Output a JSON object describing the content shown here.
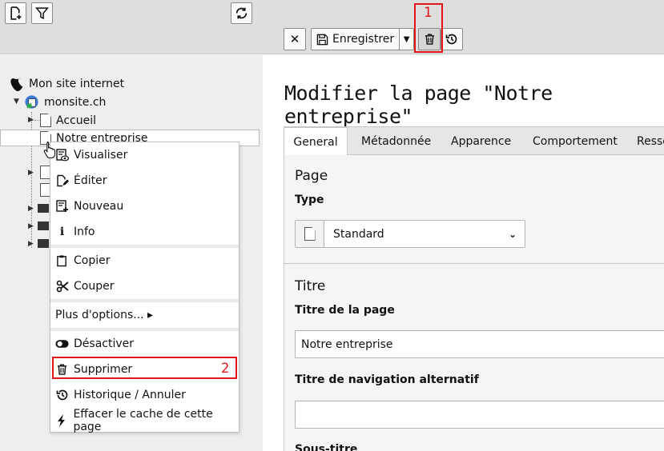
{
  "toolbar": {
    "new_page_icon": "new-page-icon",
    "filter_icon": "filter-icon",
    "refresh_icon": "refresh-icon"
  },
  "doc_toolbar": {
    "close_symbol": "✕",
    "save_label": "Enregistrer",
    "delete_icon": "trash-icon",
    "history_icon": "history-icon"
  },
  "annotations": {
    "one": "1",
    "two": "2",
    "color": "#e3131a"
  },
  "tree": {
    "root": "Mon site internet",
    "site": "monsite.ch",
    "home": "Accueil",
    "selected": "Notre entreprise"
  },
  "context_menu": {
    "items": [
      {
        "label": "Visualiser",
        "icon": "view-icon"
      },
      {
        "label": "Éditer",
        "icon": "edit-icon"
      },
      {
        "label": "Nouveau",
        "icon": "new-icon"
      },
      {
        "label": "Info",
        "icon": "info-icon"
      },
      {
        "label": "Copier",
        "icon": "copy-icon"
      },
      {
        "label": "Couper",
        "icon": "cut-icon"
      },
      {
        "label": "Plus d'options... ▸",
        "icon": ""
      },
      {
        "label": "Désactiver",
        "icon": "toggle-icon"
      },
      {
        "label": "Supprimer",
        "icon": "trash-icon"
      },
      {
        "label": "Historique / Annuler",
        "icon": "history-icon"
      },
      {
        "label": "Effacer le cache de cette page",
        "icon": "bolt-icon"
      }
    ]
  },
  "main": {
    "title": "Modifier la page \"Notre entreprise\"",
    "tabs": [
      "General",
      "Métadonnée",
      "Apparence",
      "Comportement",
      "Resso"
    ],
    "section_page": "Page",
    "type_label": "Type",
    "type_value": "Standard",
    "section_titre": "Titre",
    "page_title_label": "Titre de la page",
    "page_title_value": "Notre entreprise",
    "nav_title_label": "Titre de navigation alternatif",
    "nav_title_value": "",
    "subtitle_label": "Sous-titre"
  }
}
